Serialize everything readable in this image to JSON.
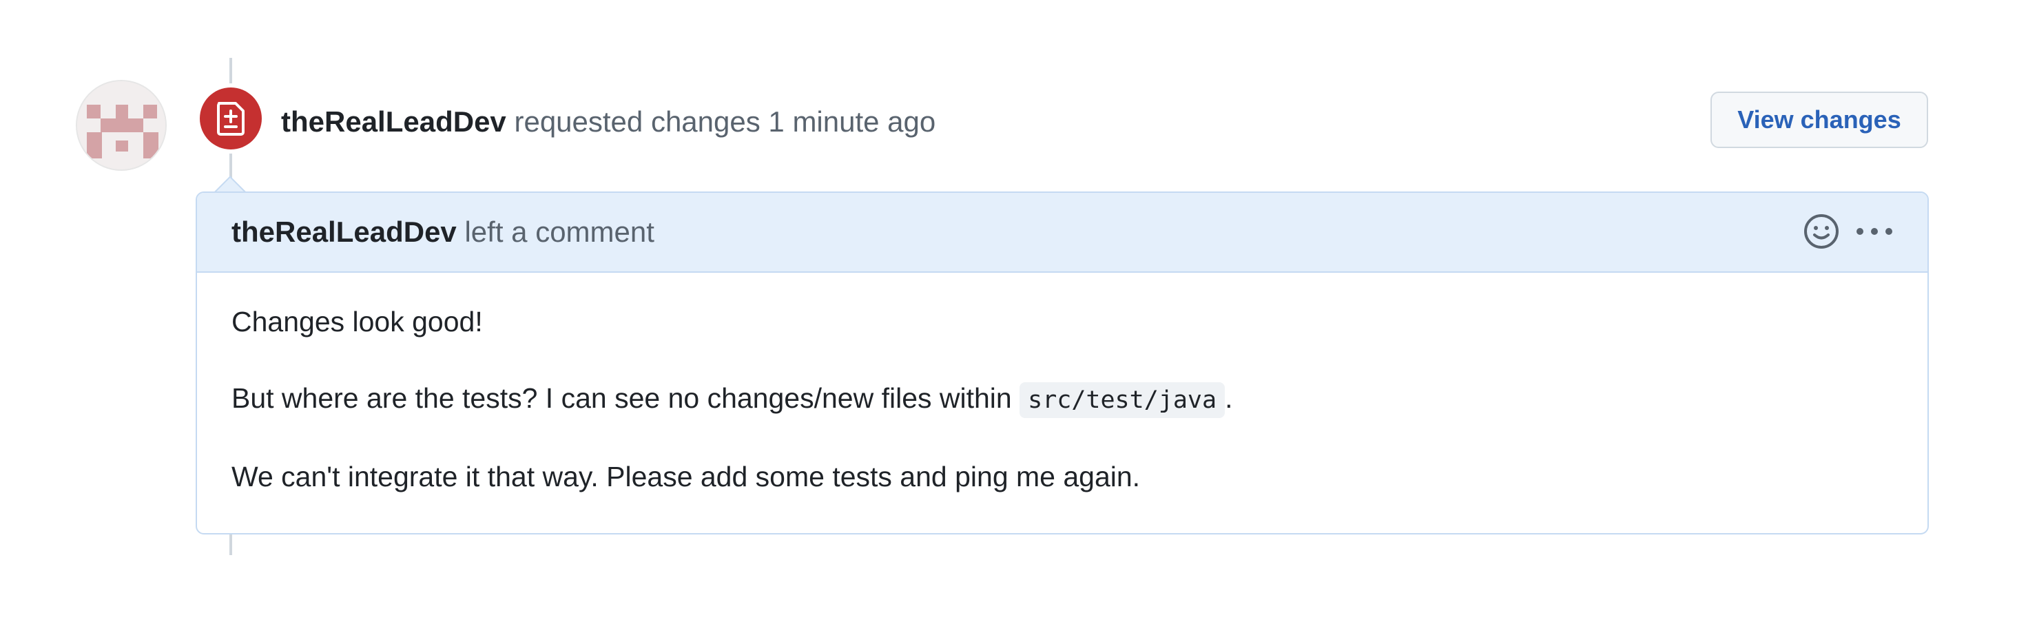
{
  "event": {
    "author": "theRealLeadDev",
    "action_text": "requested changes",
    "time": "1 minute ago",
    "badge_icon": "file-diff-icon",
    "badge_color": "#c53030"
  },
  "view_changes_button": {
    "label": "View changes"
  },
  "comment": {
    "author": "theRealLeadDev",
    "header_suffix": "left a comment",
    "icons": [
      "smiley-icon",
      "kebab-menu-icon"
    ],
    "body": {
      "line1": "Changes look good!",
      "line2_before_code": "But where are the tests? I can see no changes/new files within",
      "line2_code": "src/test/java",
      "line2_after_code": ".",
      "line3": "We can't integrate it that way. Please add some tests and ping me again."
    }
  },
  "colors": {
    "header_bg": "#e4effb",
    "border": "#c5daf2",
    "link": "#2a62b8",
    "muted": "#59636e"
  }
}
